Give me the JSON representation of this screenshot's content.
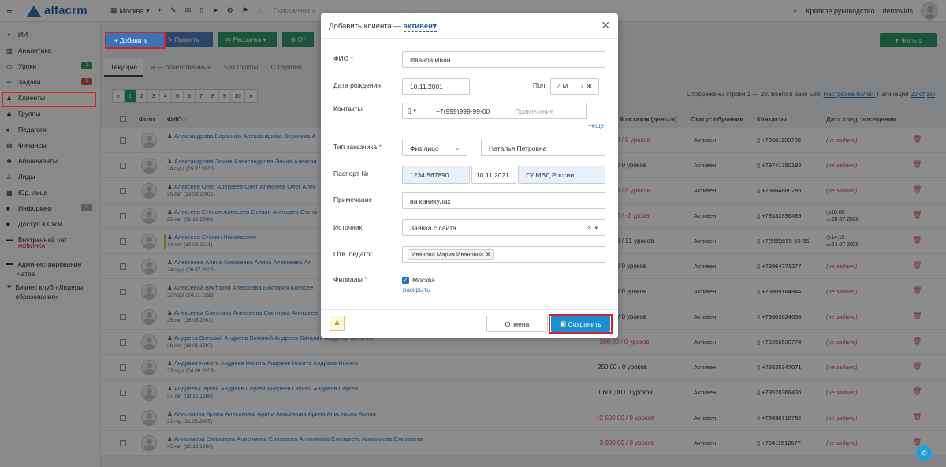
{
  "topbar": {
    "logo": "alfacrm",
    "city": "Москва",
    "search_placeholder": "Поиск клиента",
    "guide": "Краткое руководство",
    "user": "demovids"
  },
  "sidebar": {
    "items": [
      {
        "label": "ИИ",
        "icon": "sparkle-icon"
      },
      {
        "label": "Аналитика",
        "icon": "chart-icon"
      },
      {
        "label": "Уроки",
        "icon": "calendar-icon",
        "badge": "1",
        "badge_color": "#2d9c6e"
      },
      {
        "label": "Задачи",
        "icon": "tasks-icon",
        "badge": "3",
        "badge_color": "#d9534f"
      },
      {
        "label": "Клиенты",
        "icon": "user-icon"
      },
      {
        "label": "Группы",
        "icon": "group-icon"
      },
      {
        "label": "Педагоги",
        "icon": "teacher-icon"
      },
      {
        "label": "Финансы",
        "icon": "money-icon"
      },
      {
        "label": "Абонементы",
        "icon": "ticket-icon"
      },
      {
        "label": "Лиды",
        "icon": "lead-icon"
      },
      {
        "label": "Юр. лица",
        "icon": "building-icon"
      },
      {
        "label": "Информер",
        "icon": "inform-icon",
        "badge": "0",
        "badge_color": "#9ab7a6"
      },
      {
        "label": "Доступ в CRM",
        "icon": "lock-icon"
      }
    ],
    "chat": {
      "label": "Внутренний чат",
      "sub": "НОВИНКА"
    },
    "admin": "Администрирование чатов",
    "club": "Бизнес клуб «Лидеры образования»"
  },
  "toolbar": {
    "add": "+ Добавить",
    "edit": "Править",
    "mail": "Рассылка",
    "other": "От",
    "filter": "Фильтр"
  },
  "tabs": [
    "Текущие",
    "Я — ответственный",
    "Без группы",
    "С группой"
  ],
  "pager": {
    "pages": [
      "«",
      "1",
      "2",
      "3",
      "4",
      "5",
      "6",
      "7",
      "8",
      "9",
      "10",
      "»"
    ],
    "active": "1"
  },
  "rows_info": {
    "text": "Отображены строки 1 — 20. Всего в базе 520.",
    "settings": "Настройка полей.",
    "pagination": "Пагинация",
    "per_page": "20 строк"
  },
  "columns": {
    "photo": "Фото",
    "fio": "ФИО ↓",
    "balance": "й остаток (деньги)",
    "status": "Статус обучения",
    "contacts": "Контакты",
    "next_visit": "Дата след. посещения"
  },
  "rows": [
    {
      "name": "Александрова Вероника Александрова Вероника А",
      "age": "",
      "balance": "0 / 0 уроков",
      "neg": true,
      "status": "Активен",
      "phone": "+79681199798",
      "visit": "(не задано)"
    },
    {
      "name": "Александрова Элина Александрова Элина Алексан",
      "age": "24 года (25.07.2002)",
      "balance": "/ 0 уроков",
      "neg": false,
      "status": "Активен",
      "phone": "+79741760192",
      "visit": "(не задано)"
    },
    {
      "name": "Алексеев Олег Алексеев Олег Алексеев Олег Алек",
      "age": "25 лет (23.02.2001)",
      "balance": "0 / 0 уроков",
      "neg": true,
      "status": "Активен",
      "phone": "+79864880289",
      "visit": "(не задано)"
    },
    {
      "name": "Алексеев Степан Алексеев Степан Алексеев Степа",
      "age": "25 лет (02.12.2000)",
      "balance": "0 / -2 урока",
      "neg": true,
      "status": "Активен",
      "phone": "+79182896489",
      "visit_time": "10:00",
      "visit_date": "28.07.2026"
    },
    {
      "name": "Алексеев Степан Николаевич",
      "age": "14 лет (30.09.2011)",
      "balance": "0 / 31 уроков",
      "neg": false,
      "status": "Активен",
      "phone": "+7(555)555-55-55",
      "visit_time": "14:10",
      "visit_date": "24.07.2026"
    },
    {
      "name": "Алексеева Алиса Алексеева Алиса Алексеева Ал",
      "age": "24 года (06.07.2002)",
      "balance": "/ 0 уроков",
      "neg": false,
      "status": "Активен",
      "phone": "+79964771277",
      "visit": "(не задано)"
    },
    {
      "name": "Алексеева Виктория Алексеева Виктория Алексее",
      "age": "32 года (24.11.1993)",
      "balance": "/ 0 уроков",
      "neg": false,
      "status": "Активен",
      "phone": "+79809184844",
      "visit": "(не задано)"
    },
    {
      "name": "Алексеева Светлана Алексеева Светлана Алексеев",
      "age": "25 лет (15.05.2001)",
      "balance": "/ 0 уроков",
      "neg": false,
      "status": "Активен",
      "phone": "+79603624658",
      "visit": "(не задано)"
    },
    {
      "name": "Андреев Виталий Андреев Виталий Андреев Виталий Андреев Виталий",
      "age": "29 лет (18.01.1997)",
      "balance": "-200,00 / 0 уроков",
      "neg": true,
      "status": "Активен",
      "phone": "+79256530774",
      "visit": "(не задано)"
    },
    {
      "name": "Андреев Никита Андреев Никита Андреев Никита Андреев Никита",
      "age": "22 года (04.09.2003)",
      "balance": "200,00 / 0 уроков",
      "neg": false,
      "status": "Активен",
      "phone": "+79535347071",
      "visit": "(не задано)"
    },
    {
      "name": "Андреев Сергей Андреев Сергей Андреев Сергей Андреев Сергей",
      "age": "37 лет (08.12.1988)",
      "balance": "1 600,00 / 0 уроков",
      "neg": false,
      "status": "Активен",
      "phone": "+79520368436",
      "visit": "(не задано)"
    },
    {
      "name": "Анисимова Арина Анисимова Арина Анисимова Арина Анисимова Арина",
      "age": "21 год (21.05.2005)",
      "balance": "-2 600,00 / 0 уроков",
      "neg": true,
      "status": "Активен",
      "phone": "+79898716792",
      "visit": "(не задано)"
    },
    {
      "name": "Анисимова Елизавета Анисимова Елизавета Анисимова Елизавета Анисимова Елизавета",
      "age": "45 лет (15.12.1980)",
      "balance": "-3 000,00 / 0 уроков",
      "neg": true,
      "status": "Активен",
      "phone": "+79411512677",
      "visit": "(не задано)"
    }
  ],
  "modal": {
    "title": "Добавить клиента",
    "dash": "—",
    "status": "активен",
    "labels": {
      "fio": "ФИО",
      "birth": "Дата рождения",
      "gender": "Пол",
      "contacts": "Контакты",
      "customer_type": "Тип заказчика",
      "passport": "Паспорт №",
      "note": "Примечание",
      "source": "Источник",
      "teacher": "Отв. педагог",
      "branches": "Филиалы"
    },
    "values": {
      "fio": "Иванов Иван",
      "birth": "10.11.2001",
      "gender_m": "М.",
      "gender_f": "Ж.",
      "phone": "+7(999)999-99-00",
      "phone_note_placeholder": "Примечание",
      "more": "+еще",
      "customer_type": "Физ.лицо",
      "customer_name": "Наталья Петровна",
      "passport_no": "1234 567890",
      "passport_date": "10.11.2021",
      "passport_issuer": "ГУ МВД России",
      "note": "на каникулах",
      "source": "Заявка с сайта",
      "teacher": "Иванова Мария Ивановна",
      "branch": "Москва",
      "expand": "раскрыть"
    },
    "cancel": "Отмена",
    "save": "Сохранить"
  }
}
